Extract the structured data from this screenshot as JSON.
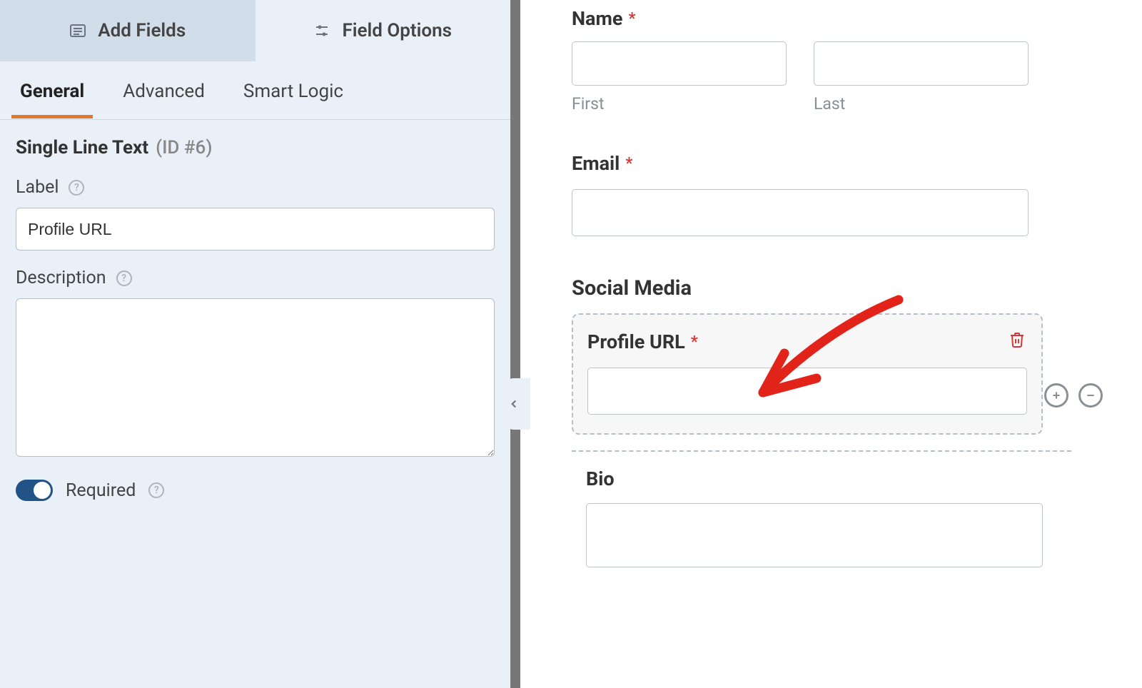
{
  "sidebar": {
    "topTabs": {
      "addFields": "Add Fields",
      "fieldOptions": "Field Options"
    },
    "subTabs": {
      "general": "General",
      "advanced": "Advanced",
      "smartLogic": "Smart Logic"
    },
    "fieldHeader": {
      "type": "Single Line Text",
      "id": "(ID #6)"
    },
    "labelOption": {
      "label": "Label",
      "value": "Profile URL"
    },
    "descOption": {
      "label": "Description",
      "value": ""
    },
    "requiredOption": {
      "label": "Required",
      "on": true
    }
  },
  "preview": {
    "nameField": {
      "label": "Name",
      "required": true,
      "sub": {
        "first": "First",
        "last": "Last"
      }
    },
    "emailField": {
      "label": "Email",
      "required": true
    },
    "sectionHeading": "Social Media",
    "profileUrlField": {
      "label": "Profile URL",
      "required": true
    },
    "bioField": {
      "label": "Bio"
    }
  },
  "colors": {
    "accent": "#e27730",
    "danger": "#d63638",
    "toggle": "#215387"
  }
}
